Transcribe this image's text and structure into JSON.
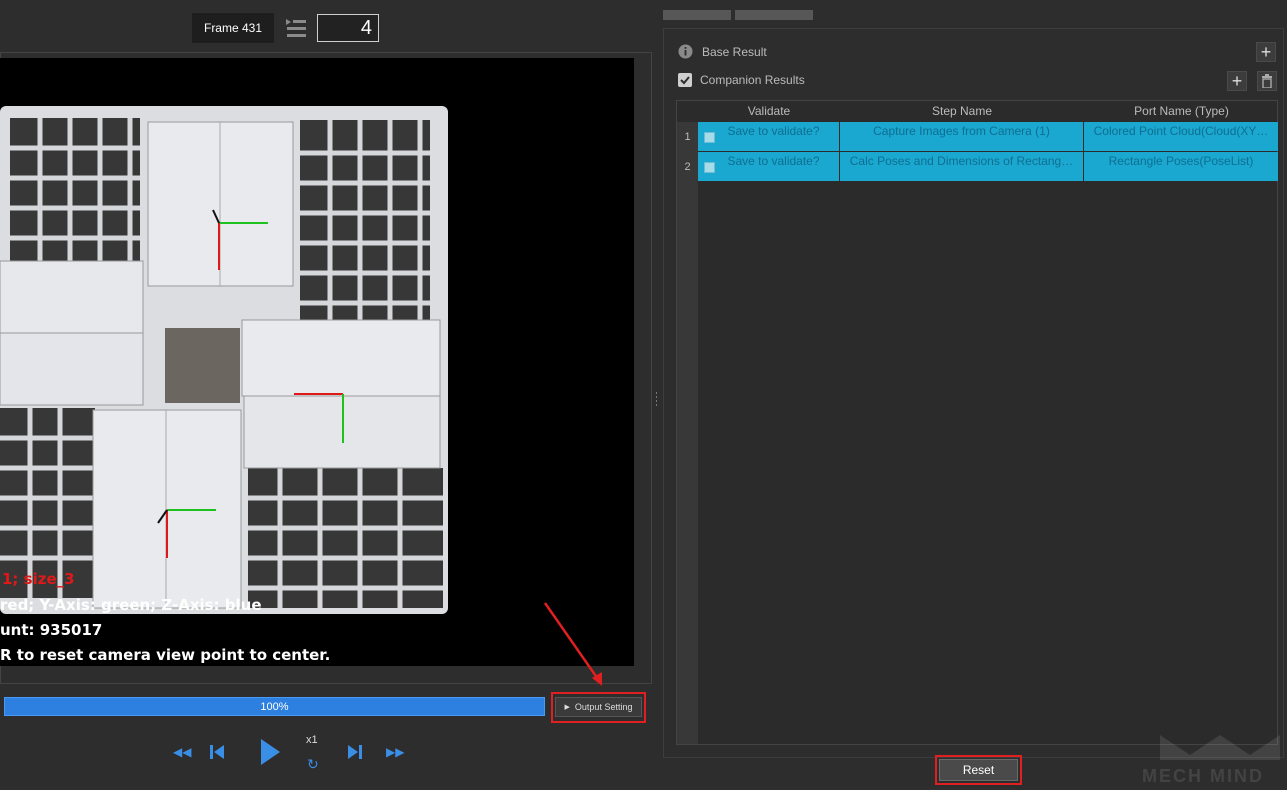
{
  "toolbar": {
    "frame_label": "Frame 431",
    "frame_input_value": "4"
  },
  "viewer": {
    "overlay_lines": [
      "1; size_3",
      "red; Y-Axis: green; Z-Axis: blue",
      "unt: 935017",
      "R to reset camera view point to center."
    ]
  },
  "playback": {
    "progress_text": "100%",
    "progress_value": 100,
    "output_setting_label": "Output Setting",
    "speed_label": "x1"
  },
  "results": {
    "base_result_label": "Base Result",
    "companion_results_label": "Companion Results",
    "companion_checked": true,
    "columns": [
      "Validate",
      "Step Name",
      "Port Name (Type)"
    ],
    "rows": [
      {
        "num": "1",
        "validate": "Save to validate?",
        "step": "Capture Images from Camera (1)",
        "port": "Colored Point Cloud(Cloud(XY…"
      },
      {
        "num": "2",
        "validate": "Save to validate?",
        "step": "Calc Poses and Dimensions of Rectang…",
        "port": "Rectangle Poses(PoseList)"
      }
    ],
    "reset_label": "Reset"
  },
  "branding": {
    "watermark": "MECH MIND"
  },
  "colors": {
    "accent": "#1aa7d0",
    "highlight_box": "#e02020",
    "progress": "#2d7fe0"
  }
}
